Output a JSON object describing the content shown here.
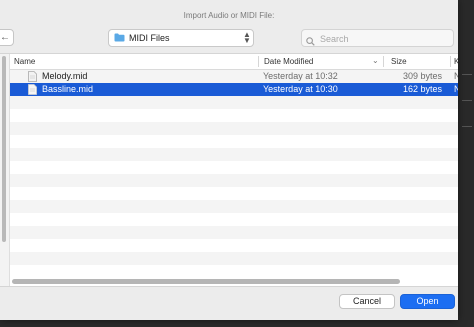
{
  "dialog": {
    "title": "Import Audio or MIDI File:",
    "back_glyph": "←"
  },
  "location": {
    "label": "MIDI Files",
    "icon": "folder-icon",
    "folder_color": "#5aa9e6"
  },
  "search": {
    "placeholder": "Search",
    "value": ""
  },
  "columns": {
    "name": "Name",
    "date": "Date Modified",
    "size": "Size",
    "kind": "K"
  },
  "files": [
    {
      "name": "Melody.mid",
      "date": "Yesterday at 10:32",
      "size": "309 bytes",
      "kind": "N",
      "selected": false
    },
    {
      "name": "Bassline.mid",
      "date": "Yesterday at 10:30",
      "size": "162 bytes",
      "kind": "N",
      "selected": true
    }
  ],
  "buttons": {
    "cancel": "Cancel",
    "open": "Open"
  },
  "colors": {
    "selection": "#1a5bd6",
    "primary_button": "#1c6ef2"
  }
}
